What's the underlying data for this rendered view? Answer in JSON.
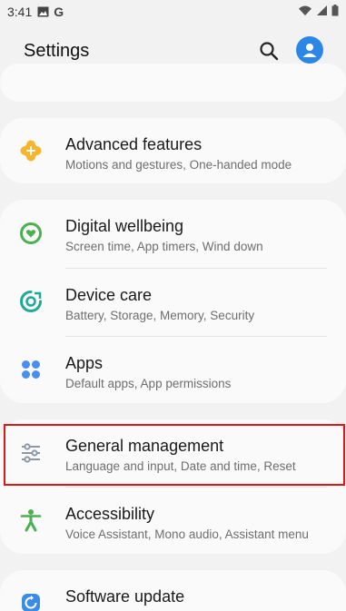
{
  "status_bar": {
    "time": "3:41",
    "icons_left": [
      "image-icon",
      "google-g-icon"
    ],
    "icons_right": [
      "wifi-icon",
      "signal-icon",
      "battery-icon"
    ]
  },
  "header": {
    "title": "Settings",
    "search_icon": "search-icon",
    "avatar_icon": "account-icon"
  },
  "items": [
    {
      "label": "Advanced features",
      "sub": "Motions and gestures, One-handed mode",
      "icon": "puzzle-plus-icon",
      "color": "#f6b52c"
    },
    {
      "label": "Digital wellbeing",
      "sub": "Screen time, App timers, Wind down",
      "icon": "wellbeing-heart-icon",
      "color": "#4cb050"
    },
    {
      "label": "Device care",
      "sub": "Battery, Storage, Memory, Security",
      "icon": "device-care-icon",
      "color": "#1ea99b"
    },
    {
      "label": "Apps",
      "sub": "Default apps, App permissions",
      "icon": "apps-grid-icon",
      "color": "#4a8ef0"
    },
    {
      "label": "General management",
      "sub": "Language and input, Date and time, Reset",
      "icon": "sliders-icon",
      "color": "#8a98a8"
    },
    {
      "label": "Accessibility",
      "sub": "Voice Assistant, Mono audio, Assistant menu",
      "icon": "accessibility-icon",
      "color": "#4caf50"
    },
    {
      "label": "Software update",
      "sub": "",
      "icon": "software-update-icon",
      "color": "#3a8de6"
    }
  ],
  "colors": {
    "highlight": "#e0161b",
    "background": "#f2f2f2",
    "card": "#fafafa"
  }
}
